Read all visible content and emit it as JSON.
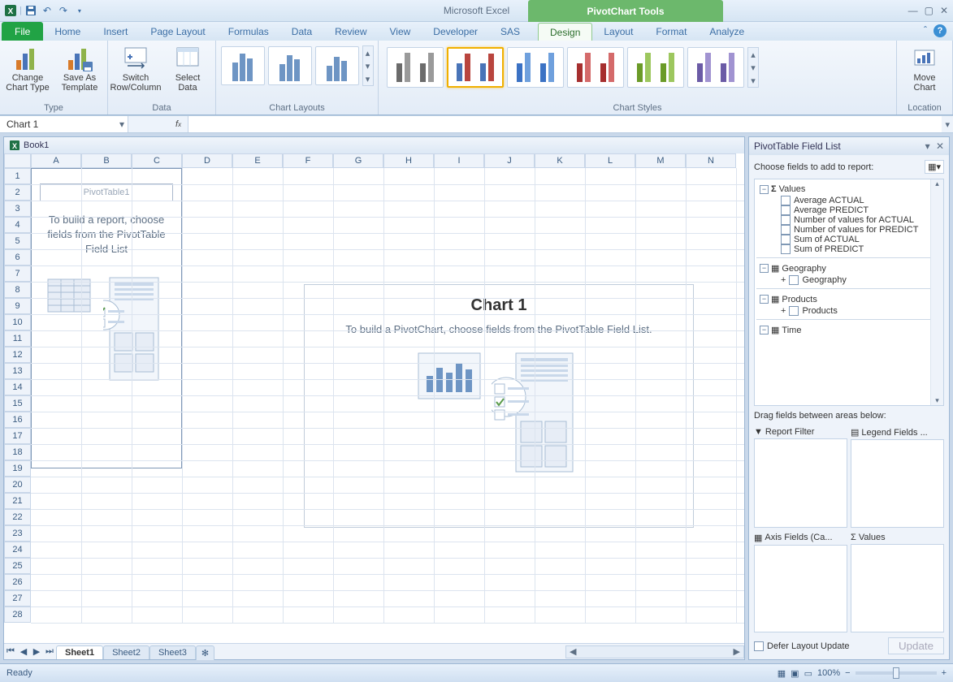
{
  "app": {
    "title": "Microsoft Excel",
    "context_title": "PivotChart Tools"
  },
  "qat": {
    "save": "save",
    "undo": "undo",
    "redo": "redo"
  },
  "tabs": {
    "file": "File",
    "items": [
      "Home",
      "Insert",
      "Page Layout",
      "Formulas",
      "Data",
      "Review",
      "View",
      "Developer",
      "SAS"
    ],
    "ctx": [
      "Design",
      "Layout",
      "Format",
      "Analyze"
    ],
    "active": "Design"
  },
  "ribbon": {
    "type": {
      "label": "Type",
      "change": "Change\nChart Type",
      "save_as": "Save As\nTemplate"
    },
    "data": {
      "label": "Data",
      "switch": "Switch\nRow/Column",
      "select": "Select\nData"
    },
    "chart_layouts": {
      "label": "Chart Layouts"
    },
    "chart_styles": {
      "label": "Chart Styles"
    },
    "location": {
      "label": "Location",
      "move": "Move\nChart"
    }
  },
  "namebox": "Chart 1",
  "book": "Book1",
  "columns": [
    "A",
    "B",
    "C",
    "D",
    "E",
    "F",
    "G",
    "H",
    "I",
    "J",
    "K",
    "L",
    "M",
    "N"
  ],
  "rows": [
    1,
    2,
    3,
    4,
    5,
    6,
    7,
    8,
    9,
    10,
    11,
    12,
    13,
    14,
    15,
    16,
    17,
    18,
    19,
    20,
    21,
    22,
    23,
    24,
    25,
    26,
    27,
    28
  ],
  "pivot": {
    "name": "PivotTable1",
    "hint": "To build a report, choose fields from the PivotTable Field List"
  },
  "chart": {
    "title": "Chart 1",
    "hint": "To build a PivotChart, choose fields from the PivotTable Field List."
  },
  "sheets": {
    "tabs": [
      "Sheet1",
      "Sheet2",
      "Sheet3"
    ],
    "active": "Sheet1"
  },
  "fieldlist": {
    "title": "PivotTable Field List",
    "prompt": "Choose fields to add to report:",
    "groups": [
      {
        "name": "Values",
        "sigma": true,
        "expanded": true,
        "children": [
          "Average ACTUAL",
          "Average PREDICT",
          "Number of values for ACTUAL",
          "Number of values for PREDICT",
          "Sum of ACTUAL",
          "Sum of PREDICT"
        ]
      },
      {
        "name": "Geography",
        "expanded": true,
        "children": [
          "Geography"
        ],
        "childExpand": true
      },
      {
        "name": "Products",
        "expanded": true,
        "children": [
          "Products"
        ],
        "childExpand": true
      },
      {
        "name": "Time",
        "expanded": false,
        "children": []
      }
    ],
    "drag_hdr": "Drag fields between areas below:",
    "areas": {
      "filter": "Report Filter",
      "legend": "Legend Fields ...",
      "axis": "Axis Fields (Ca...",
      "values": "Values"
    },
    "defer": "Defer Layout Update",
    "update": "Update"
  },
  "status": {
    "ready": "Ready",
    "zoom": "100%"
  }
}
